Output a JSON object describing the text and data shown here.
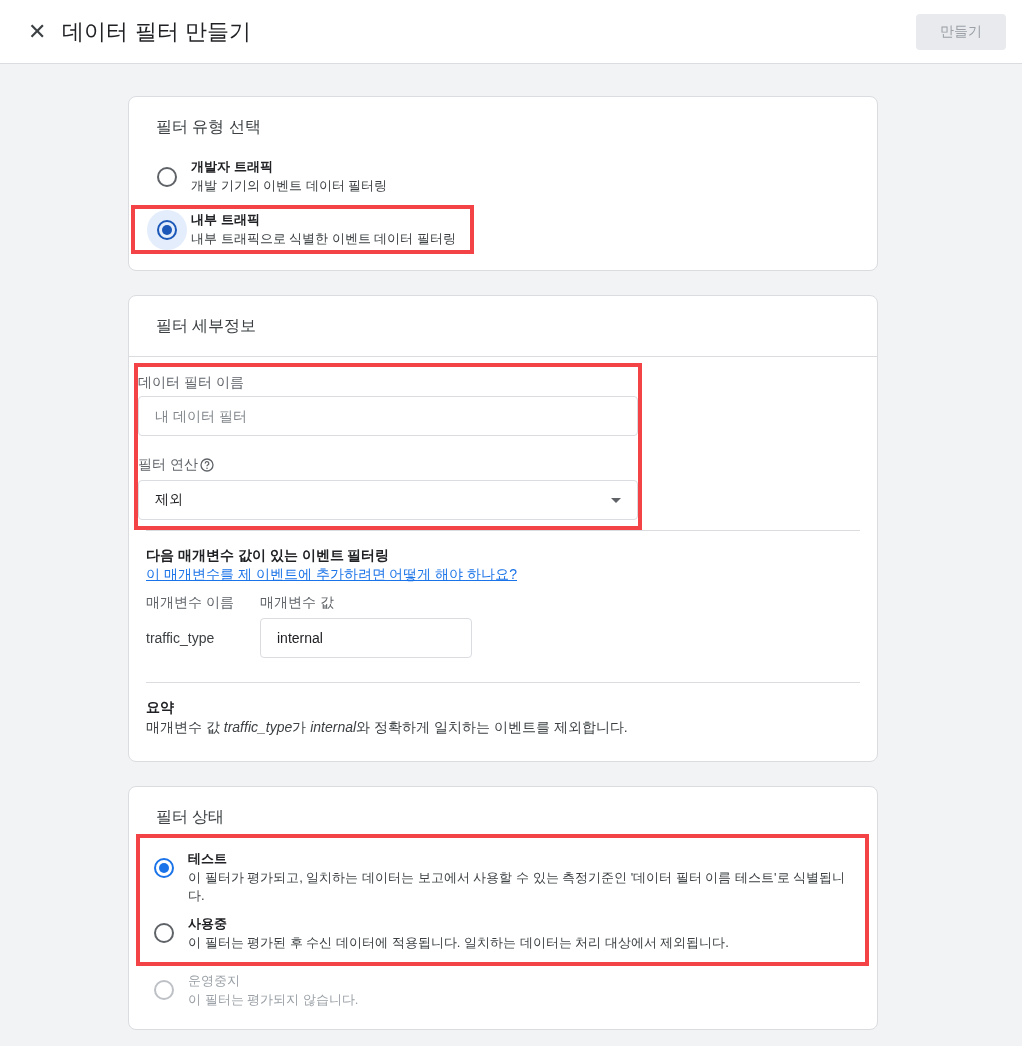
{
  "header": {
    "close_icon": "✕",
    "title": "데이터 필터 만들기",
    "create_button": {
      "label": "만들기",
      "disabled": true
    }
  },
  "filter_type": {
    "title": "필터 유형 선택",
    "options": [
      {
        "label": "개발자 트래픽",
        "description": "개발 기기의 이벤트 데이터 필터링",
        "selected": false,
        "highlighted": false
      },
      {
        "label": "내부 트래픽",
        "description": "내부 트래픽으로 식별한 이벤트 데이터 필터링",
        "selected": true,
        "highlighted": true
      }
    ]
  },
  "details": {
    "title": "필터 세부정보",
    "highlighted": true,
    "name_field": {
      "label": "데이터 필터 이름",
      "placeholder": "내 데이터 필터"
    },
    "operation_field": {
      "label": "필터 연산",
      "value": "제외"
    },
    "params": {
      "heading": "다음 매개변수 값이 있는 이벤트 필터링",
      "link": "이 매개변수를 제 이벤트에 추가하려면 어떻게 해야 하나요?",
      "name_header": "매개변수 이름",
      "value_header": "매개변수 값",
      "name": "traffic_type",
      "value": "internal"
    },
    "summary": {
      "heading": "요약",
      "parts": [
        {
          "text": "매개변수 값 ",
          "italic": false
        },
        {
          "text": "traffic_type",
          "italic": true
        },
        {
          "text": "가 ",
          "italic": false
        },
        {
          "text": "internal",
          "italic": true
        },
        {
          "text": "와 정확하게 일치하는 이벤트를 제외합니다.",
          "italic": false
        }
      ]
    }
  },
  "status": {
    "title": "필터 상태",
    "options": [
      {
        "label": "테스트",
        "description": "이 필터가 평가되고, 일치하는 데이터는 보고에서 사용할 수 있는 측정기준인 '데이터 필터 이름 테스트'로 식별됩니다.",
        "selected": true,
        "disabled": false,
        "highlighted": true
      },
      {
        "label": "사용중",
        "description": "이 필터는 평가된 후 수신 데이터에 적용됩니다. 일치하는 데이터는 처리 대상에서 제외됩니다.",
        "selected": false,
        "disabled": false,
        "highlighted": true
      },
      {
        "label": "운영중지",
        "description": "이 필터는 평가되지 않습니다.",
        "selected": false,
        "disabled": true,
        "highlighted": false
      }
    ]
  }
}
